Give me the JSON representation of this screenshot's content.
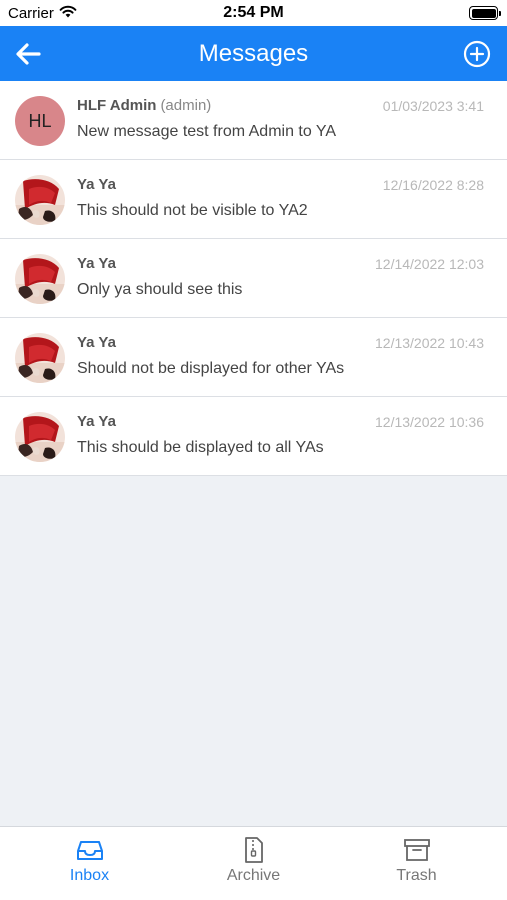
{
  "status_bar": {
    "carrier": "Carrier",
    "time": "2:54 PM"
  },
  "header": {
    "title": "Messages",
    "back_icon": "arrow-left-icon",
    "add_icon": "plus-circle-icon"
  },
  "colors": {
    "accent": "#1a82f5",
    "header_bg": "#1a82f5",
    "avatar_initials_bg": "#d8868a",
    "list_bg": "#ffffff",
    "page_bg": "#eef1f5"
  },
  "messages": [
    {
      "avatar_initials": "HL",
      "sender": "HLF Admin",
      "handle": "(admin)",
      "date": "01/03/2023 3:41",
      "preview": "New message test from Admin to YA"
    },
    {
      "sender": "Ya Ya",
      "date": "12/16/2022 8:28",
      "preview": "This should not be visible to YA2"
    },
    {
      "sender": "Ya Ya",
      "date": "12/14/2022 12:03",
      "preview": "Only ya should see this"
    },
    {
      "sender": "Ya Ya",
      "date": "12/13/2022 10:43",
      "preview": "Should not be displayed for other YAs"
    },
    {
      "sender": "Ya Ya",
      "date": "12/13/2022 10:36",
      "preview": "This should be displayed to all YAs"
    }
  ],
  "tabs": [
    {
      "label": "Inbox",
      "icon": "inbox-icon",
      "active": true
    },
    {
      "label": "Archive",
      "icon": "archive-file-icon",
      "active": false
    },
    {
      "label": "Trash",
      "icon": "trash-box-icon",
      "active": false
    }
  ]
}
